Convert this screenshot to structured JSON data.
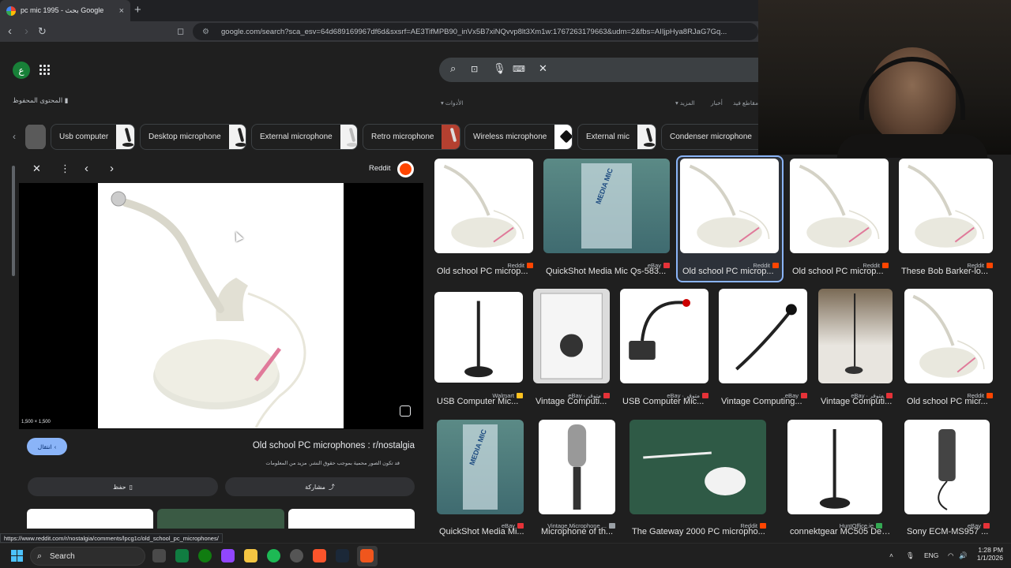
{
  "browser": {
    "tab_title": "pc mic 1995 - بحث Google",
    "tab_close": "×",
    "new_tab": "+",
    "url": "google.com/search?sca_esv=64d689169967df6d&sxsrf=AE3TifMPB90_inVx5B7xiNQvvp8lt3Xm1w:1767263179663&udm=2&fbs=AIIjpHya8RJaG7Gq..."
  },
  "google": {
    "avatar_letter": "ع",
    "saved_label": "المحتوى المحفوظ",
    "filters": {
      "short": "مقاطع فيديو قصيرة",
      "news": "أخبار",
      "more": "المزيد",
      "tools": "الأدوات"
    },
    "chips": [
      {
        "label": "Usb computer"
      },
      {
        "label": "Desktop microphone"
      },
      {
        "label": "External microphone"
      },
      {
        "label": "Retro microphone"
      },
      {
        "label": "Wireless microphone"
      },
      {
        "label": "External mic"
      },
      {
        "label": "Condenser microphone"
      }
    ]
  },
  "viewer": {
    "source": "Reddit",
    "image_size": "1,500 × 1,500",
    "visit_label": "انتقال",
    "title": "Old school PC microphones : r/nostalgia",
    "note": "قد تكون الصور محمية بموجب حقوق النشر.  مزيد من المعلومات",
    "save_label": "حفظ",
    "share_label": "مشاركة"
  },
  "results": [
    {
      "title": "Old school PC microp...",
      "source": "Reddit",
      "badge": "#ff4500"
    },
    {
      "title": "QuickShot Media Mic Qs-583...",
      "source": "eBay",
      "badge": "#e53238"
    },
    {
      "title": "Old school PC microp...",
      "source": "Reddit",
      "badge": "#ff4500"
    },
    {
      "title": "Old school PC microp...",
      "source": "Reddit",
      "badge": "#ff4500"
    },
    {
      "title": "These Bob Barker-lo...",
      "source": "Reddit",
      "badge": "#ff4500"
    },
    {
      "title": "USB Computer Mic...",
      "source": "Walmart",
      "badge": "#ffc220"
    },
    {
      "title": "Vintage Computi...",
      "source": "eBay · متوفر",
      "badge": "#e53238"
    },
    {
      "title": "USB Computer Mic...",
      "source": "eBay · متوفر",
      "badge": "#e53238"
    },
    {
      "title": "Vintage Computing...",
      "source": "eBay",
      "badge": "#e53238"
    },
    {
      "title": "Vintage Computi...",
      "source": "eBay · متوفر",
      "badge": "#e53238"
    },
    {
      "title": "Old school PC micr...",
      "source": "Reddit",
      "badge": "#ff4500"
    },
    {
      "title": "QuickShot Media Mi...",
      "source": "eBay",
      "badge": "#e53238"
    },
    {
      "title": "Microphone of th...",
      "source": "Vintage Microphone ...",
      "badge": "#9aa0a6"
    },
    {
      "title": "The Gateway 2000 PC micropho...",
      "source": "Reddit",
      "badge": "#ff4500"
    },
    {
      "title": "connektgear MC505 Des...",
      "source": "HuntOffice.ie",
      "badge": "#34a853"
    },
    {
      "title": "Sony ECM-MS957 ...",
      "source": "eBay",
      "badge": "#e53238"
    }
  ],
  "status_url": "https://www.reddit.com/r/nostalgia/comments/lpcg1c/old_school_pc_microphones/",
  "taskbar": {
    "search_label": "Search",
    "lang": "ENG",
    "time": "1:28 PM",
    "date": "1/1/2026"
  },
  "colors": {
    "accent": "#8ab4f8",
    "bg": "#1f1f1f",
    "reddit": "#ff4500"
  }
}
